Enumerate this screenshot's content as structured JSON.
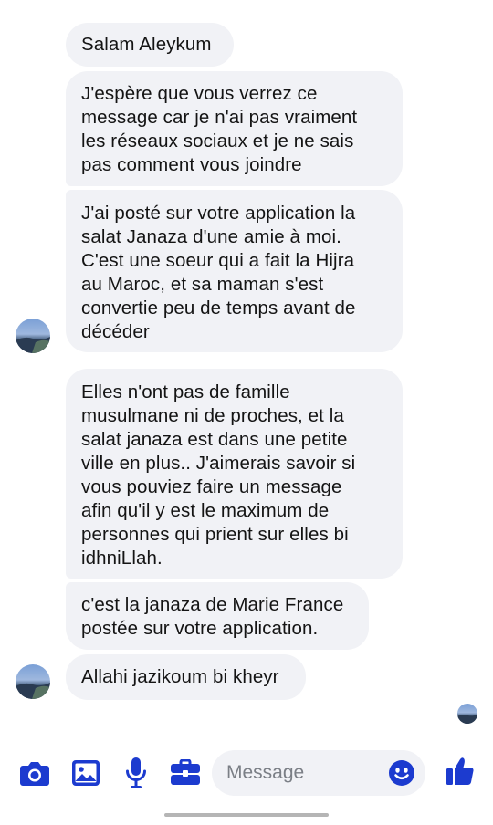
{
  "messages": [
    {
      "text": "Salam Aleykum"
    },
    {
      "text": "J'espère que vous verrez ce\nmessage car je n'ai pas vraiment\nles réseaux sociaux et je ne sais\npas comment vous joindre"
    },
    {
      "text": "J'ai posté sur votre application la\nsalat Janaza d'une amie à moi.\nC'est une soeur qui a fait la Hijra\nau Maroc, et sa maman s'est\nconvertie peu de temps avant de\ndécéder"
    },
    {
      "text": "Elles n'ont pas de famille\nmusulmane ni de proches, et la\nsalat janaza est dans une petite\nville en plus.. J'aimerais savoir si\nvous pouviez faire un message\nafin qu'il y est le maximum de\npersonnes qui prient sur elles bi\nidhniLlah."
    },
    {
      "text": "c'est la janaza de Marie France\npostée sur votre application."
    },
    {
      "text": "Allahi jazikoum bi kheyr"
    }
  ],
  "composer": {
    "placeholder": "Message",
    "accent_color": "#1c3bcf",
    "icons": [
      "camera-icon",
      "image-icon",
      "microphone-icon",
      "briefcase-icon",
      "emoji-icon",
      "thumbs-up-icon"
    ]
  },
  "colors": {
    "bubble_bg": "#f1f2f6",
    "text": "#141414",
    "accent": "#1c3bcf"
  }
}
